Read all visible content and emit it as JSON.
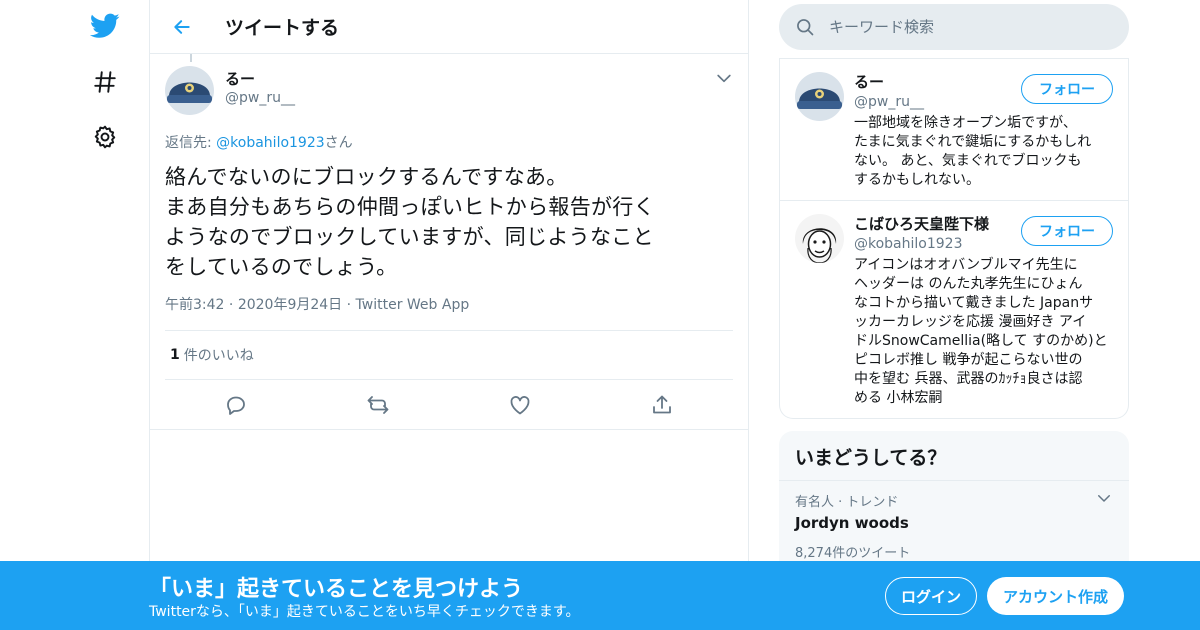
{
  "colors": {
    "accent": "#1da1f2",
    "link": "#1b95e0",
    "secondary_text": "#657786",
    "border": "#e6ecf0"
  },
  "nav": {
    "items": [
      {
        "icon": "twitter-bird-icon"
      },
      {
        "icon": "hashtag-icon"
      },
      {
        "icon": "gear-icon"
      }
    ]
  },
  "header": {
    "title": "ツイートする"
  },
  "tweet": {
    "author_name": "るー",
    "author_handle": "@pw_ru__",
    "reply_prefix": "返信先: ",
    "reply_handle": "@kobahilo1923",
    "reply_suffix": "さん",
    "text_lines": [
      "絡んでないのにブロックするんですなあ。",
      "まあ自分もあちらの仲間っぽいヒトから報告が行く",
      "ようなのでブロックしていますが、同じようなこと",
      "をしているのでしょう。"
    ],
    "time": "午前3:42",
    "date": "2020年9月24日",
    "source": "Twitter Web App",
    "sep": "·",
    "likes_count": "1",
    "likes_label": "件のいいね"
  },
  "search": {
    "placeholder": "キーワード検索"
  },
  "users": [
    {
      "name": "るー",
      "handle": "@pw_ru__",
      "follow_label": "フォロー",
      "bio_lines": [
        "一部地域を除きオープン垢ですが、",
        "たまに気まぐれで鍵垢にするかもしれ",
        "ない。 あと、気まぐれでブロックも",
        "するかもしれない。"
      ]
    },
    {
      "name": "こばひろ天皇陛下様",
      "handle": "@kobahilo1923",
      "follow_label": "フォロー",
      "bio_lines": [
        "アイコンはオオバンブルマイ先生に",
        "ヘッダーは のんた丸孝先生にひょん",
        "なコトから描いて戴きました Japanサ",
        "ッカーカレッジを応援 漫画好き アイ",
        "ドルSnowCamellia(略して すのかめ)と",
        "ピコレボ推し 戦争が起こらない世の",
        "中を望む 兵器、武器のｶｯﾁｮ良さは認",
        "める 小林宏嗣"
      ]
    }
  ],
  "trends": {
    "title": "いまどうしてる？",
    "items": [
      {
        "meta": "有名人 · トレンド",
        "name": "Jordyn woods",
        "count": "8,274件のツイート"
      }
    ]
  },
  "banner": {
    "title": "「いま」起きていることを見つけよう",
    "subtitle": "Twitterなら、「いま」起きていることをいち早くチェックできます。",
    "login_label": "ログイン",
    "signup_label": "アカウント作成"
  }
}
